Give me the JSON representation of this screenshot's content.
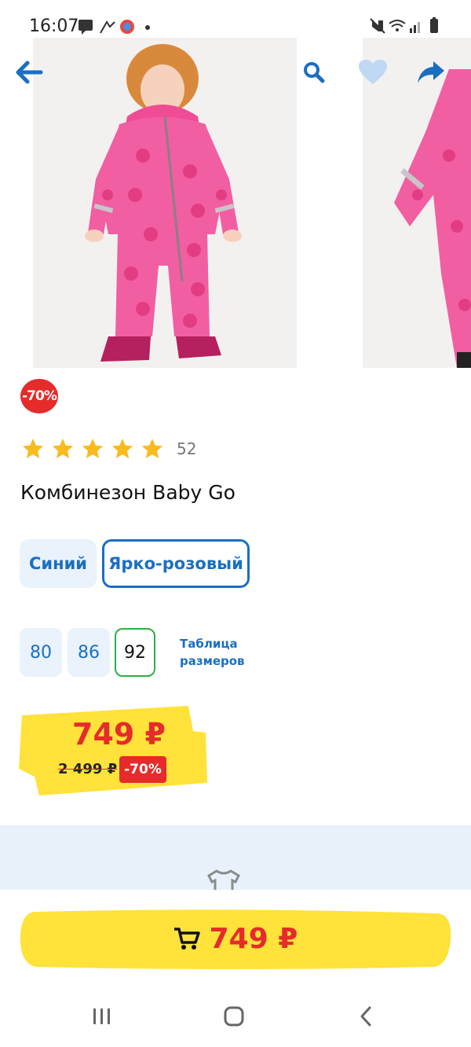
{
  "status_bar": {
    "time": "16:07"
  },
  "product": {
    "discount_badge": "-70%",
    "rating_stars": 5,
    "reviews_count": "52",
    "title": "Комбинезон Baby Go"
  },
  "colors": [
    {
      "label": "Синий",
      "selected": false
    },
    {
      "label": "Ярко-розовый",
      "selected": true
    }
  ],
  "sizes": [
    {
      "label": "80",
      "selected": false
    },
    {
      "label": "86",
      "selected": false
    },
    {
      "label": "92",
      "selected": true
    }
  ],
  "size_table_link": {
    "line1": "Таблица",
    "line2": "размеров"
  },
  "price": {
    "current": "749 ₽",
    "old": "2 499 ₽",
    "discount": "-70%"
  },
  "cart_button": {
    "price": "749 ₽"
  },
  "theme": {
    "accent_blue": "#1a6fc2",
    "price_red": "#e52b2b",
    "yellow": "#ffe23a",
    "size_selected_green": "#2fae43",
    "star_yellow": "#f9bb1d"
  },
  "icons": {
    "back": "arrow-left-icon",
    "search": "search-icon",
    "favorite": "heart-icon",
    "share": "share-icon",
    "cart": "cart-icon"
  }
}
